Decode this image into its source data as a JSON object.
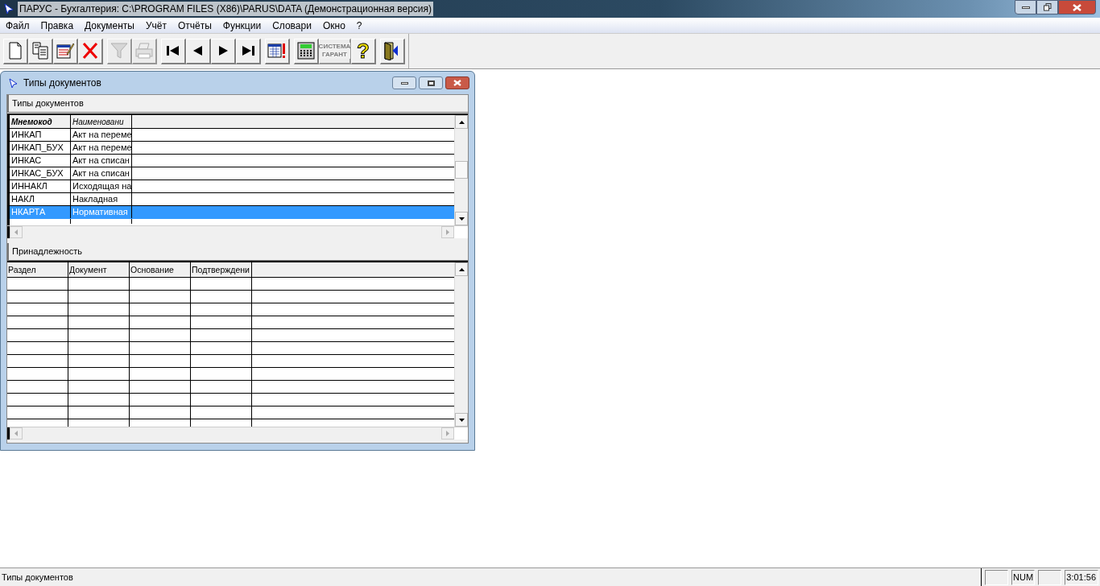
{
  "window": {
    "title": "ПАРУС - Бухгалтерия: C:\\PROGRAM FILES (X86)\\PARUS\\DATA (Демонстрационная версия)"
  },
  "menu": [
    "Файл",
    "Правка",
    "Документы",
    "Учёт",
    "Отчёты",
    "Функции",
    "Словари",
    "Окно",
    "?"
  ],
  "toolbar": [
    [
      {
        "kind": "new",
        "disabled": false
      },
      {
        "kind": "copy",
        "disabled": false
      },
      {
        "kind": "edit",
        "disabled": false
      },
      {
        "kind": "delete",
        "disabled": false
      }
    ],
    [
      {
        "kind": "filter",
        "disabled": true
      },
      {
        "kind": "print",
        "disabled": true
      }
    ],
    [
      {
        "kind": "first",
        "disabled": false
      },
      {
        "kind": "prev",
        "disabled": false
      },
      {
        "kind": "next",
        "disabled": false
      },
      {
        "kind": "last",
        "disabled": false
      }
    ],
    [
      {
        "kind": "alert",
        "disabled": false
      }
    ],
    [
      {
        "kind": "calculator",
        "disabled": false
      },
      {
        "kind": "garant",
        "disabled": true,
        "caption": [
          "СИСТЕМА",
          "ГАРАНТ"
        ]
      },
      {
        "kind": "help",
        "disabled": false,
        "glyph": "?"
      }
    ],
    [
      {
        "kind": "exit",
        "disabled": false
      }
    ]
  ],
  "child_window": {
    "title": "Типы документов",
    "upper": {
      "caption": "Типы документов",
      "columns": [
        "Мнемокод",
        "Наименовани"
      ],
      "rows": [
        {
          "cells": [
            "ИНКАП",
            "Акт на переме"
          ],
          "selected": false
        },
        {
          "cells": [
            "ИНКАП_БУХ",
            "Акт на переме"
          ],
          "selected": false
        },
        {
          "cells": [
            "ИНКАС",
            "Акт на списан"
          ],
          "selected": false
        },
        {
          "cells": [
            "ИНКАС_БУХ",
            "Акт на списан"
          ],
          "selected": false
        },
        {
          "cells": [
            "ИННАКЛ",
            "Исходящая на"
          ],
          "selected": false
        },
        {
          "cells": [
            "НАКЛ",
            "Накладная"
          ],
          "selected": false
        },
        {
          "cells": [
            "НКАРТА",
            "Нормативная"
          ],
          "selected": true
        }
      ]
    },
    "lower": {
      "caption": "Принадлежность",
      "columns": [
        "Раздел",
        "Документ",
        "Основание",
        "Подтверждени"
      ]
    }
  },
  "status_bar": {
    "text": "Типы документов",
    "num_indicator": "NUM",
    "clock": "3:01:56"
  }
}
